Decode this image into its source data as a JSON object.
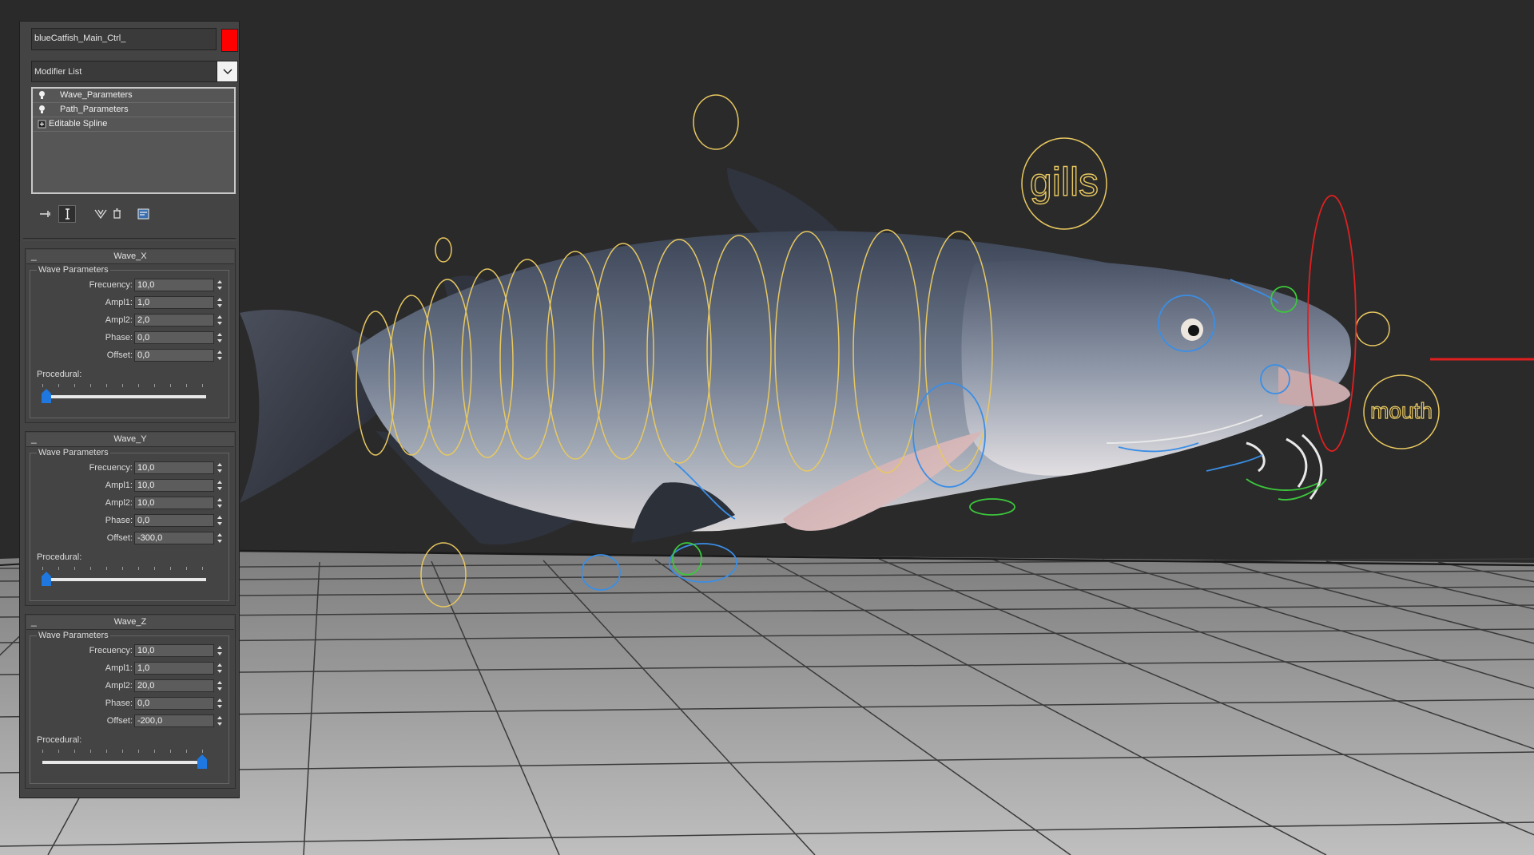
{
  "scene": {
    "labels": {
      "gills": "gills",
      "mouth": "mouth"
    }
  },
  "panel": {
    "object_name": "blueCatfish_Main_Ctrl_",
    "object_color": "#ff0000",
    "modifier_list": "Modifier List",
    "stack": [
      {
        "label": "Wave_Parameters",
        "icon": "bulb-icon"
      },
      {
        "label": "Path_Parameters",
        "icon": "bulb-icon"
      },
      {
        "label": "Editable Spline",
        "icon": "expand-icon"
      }
    ],
    "toolbar": [
      "pin-stack-icon",
      "show-end-result-icon",
      "make-unique-icon",
      "remove-modifier-icon",
      "configure-sets-icon"
    ],
    "rollouts": [
      {
        "title": "Wave_X",
        "group": "Wave Parameters",
        "params": [
          {
            "label": "Frecuency:",
            "value": "10,0"
          },
          {
            "label": "Ampl1:",
            "value": "1,0"
          },
          {
            "label": "Ampl2:",
            "value": "2,0"
          },
          {
            "label": "Phase:",
            "value": "0,0"
          },
          {
            "label": "Offset:",
            "value": "0,0"
          }
        ],
        "procedural_label": "Procedural:",
        "procedural_value": 0
      },
      {
        "title": "Wave_Y",
        "group": "Wave Parameters",
        "params": [
          {
            "label": "Frecuency:",
            "value": "10,0"
          },
          {
            "label": "Ampl1:",
            "value": "10,0"
          },
          {
            "label": "Ampl2:",
            "value": "10,0"
          },
          {
            "label": "Phase:",
            "value": "0,0"
          },
          {
            "label": "Offset:",
            "value": "-300,0"
          }
        ],
        "procedural_label": "Procedural:",
        "procedural_value": 0
      },
      {
        "title": "Wave_Z",
        "group": "Wave Parameters",
        "params": [
          {
            "label": "Frecuency:",
            "value": "10,0"
          },
          {
            "label": "Ampl1:",
            "value": "1,0"
          },
          {
            "label": "Ampl2:",
            "value": "20,0"
          },
          {
            "label": "Phase:",
            "value": "0,0"
          },
          {
            "label": "Offset:",
            "value": "-200,0"
          }
        ],
        "procedural_label": "Procedural:",
        "procedural_value": 1
      }
    ]
  },
  "colors": {
    "slider_thumb": "#1e78e0",
    "control_yellow": "#e8c860",
    "control_blue": "#3a8ee6",
    "control_green": "#3cc83c",
    "control_red": "#e02020"
  }
}
